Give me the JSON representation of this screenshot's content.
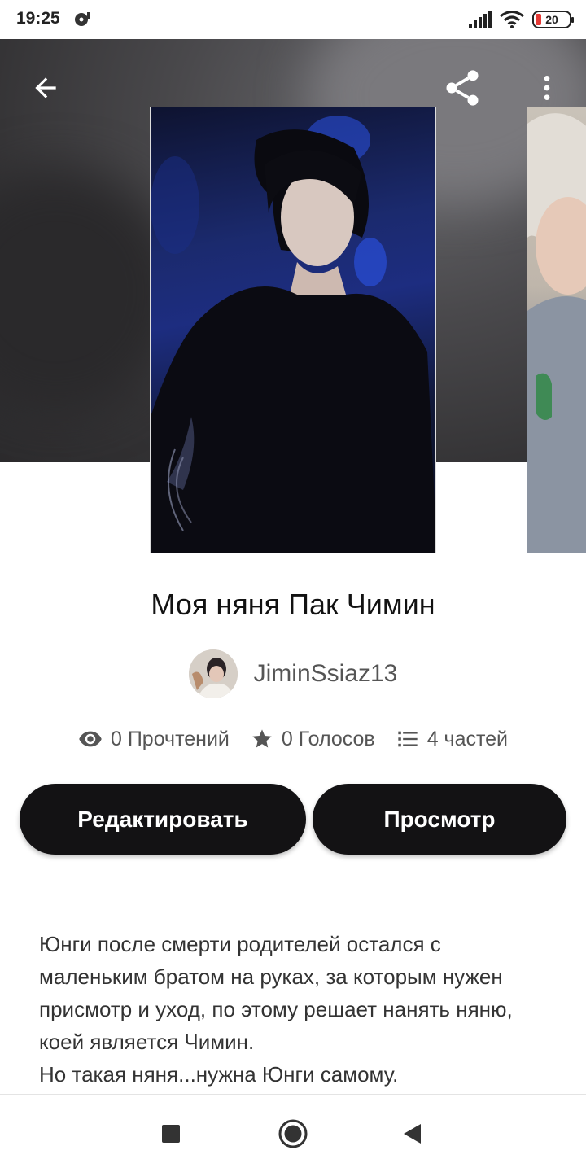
{
  "status_bar": {
    "time": "19:25",
    "battery": "20"
  },
  "header": {
    "icons": [
      "back-arrow-icon",
      "share-icon",
      "more-vert-icon"
    ]
  },
  "story": {
    "title": "Моя няня Пак Чимин",
    "author": "JiminSsiaz13",
    "stats": {
      "reads": "0 Прочтений",
      "votes": "0 Голосов",
      "parts": "4 частей"
    },
    "description": "Юнги после смерти родителей остался с маленьким братом на руках, за которым нужен присмотр и уход, по этому решает нанять няню, коей является Чимин.\nНо такая няня...нужна Юнги самому."
  },
  "actions": {
    "edit_label": "Редактировать",
    "view_label": "Просмотр"
  },
  "colors": {
    "button_bg": "#131214",
    "hero_bg": "#3a393c",
    "battery_low": "#e53935"
  }
}
